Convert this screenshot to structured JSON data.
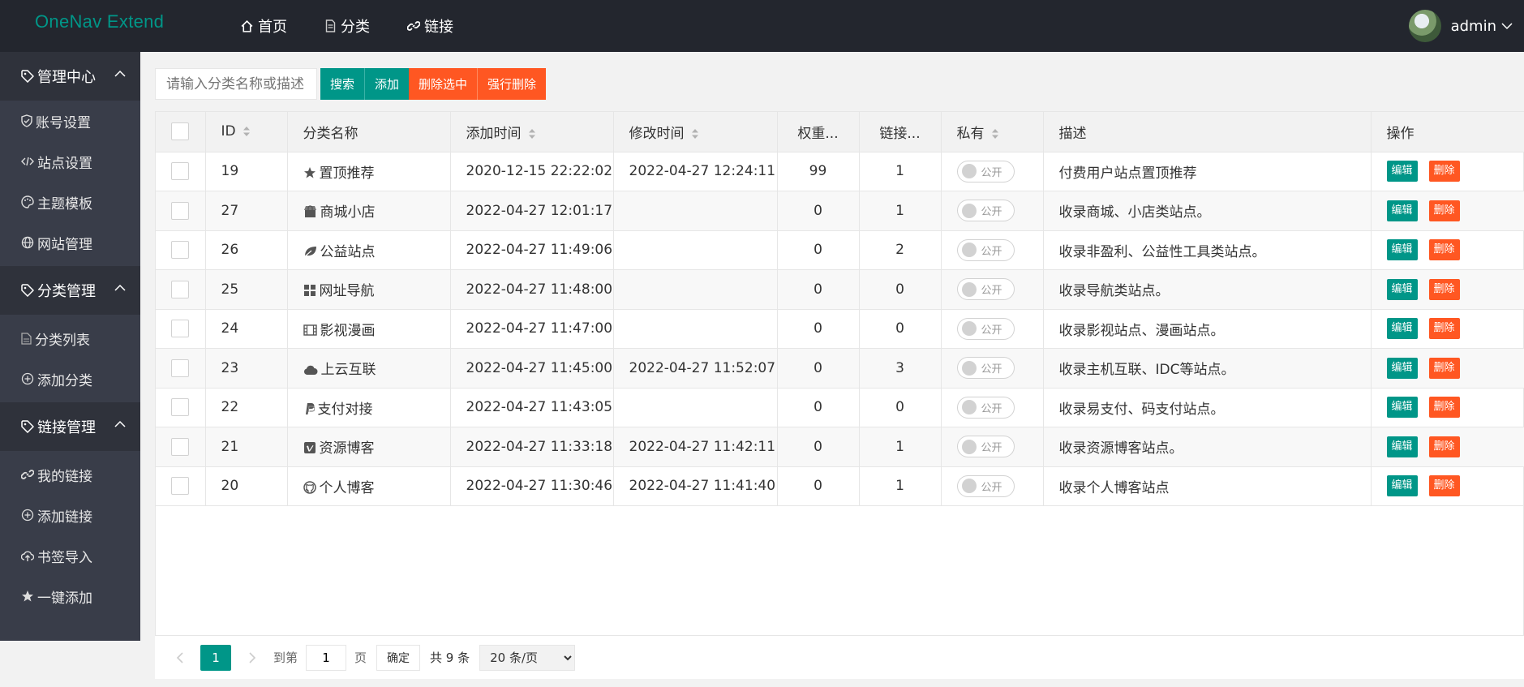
{
  "app": {
    "title": "OneNav Extend"
  },
  "topnav": [
    {
      "icon": "home-icon",
      "label": "首页"
    },
    {
      "icon": "document-icon",
      "label": "分类"
    },
    {
      "icon": "link-icon",
      "label": "链接"
    }
  ],
  "user": {
    "name": "admin"
  },
  "sidebar": {
    "groups": [
      {
        "title": "管理中心",
        "items": [
          {
            "icon": "shield-icon",
            "label": "账号设置"
          },
          {
            "icon": "code-icon",
            "label": "站点设置"
          },
          {
            "icon": "palette-icon",
            "label": "主题模板"
          },
          {
            "icon": "globe-icon",
            "label": "网站管理"
          }
        ]
      },
      {
        "title": "分类管理",
        "items": [
          {
            "icon": "file-icon",
            "label": "分类列表"
          },
          {
            "icon": "plus-circle-icon",
            "label": "添加分类"
          }
        ]
      },
      {
        "title": "链接管理",
        "items": [
          {
            "icon": "link-icon",
            "label": "我的链接"
          },
          {
            "icon": "plus-circle-icon",
            "label": "添加链接"
          },
          {
            "icon": "cloud-upload-icon",
            "label": "书签导入"
          },
          {
            "icon": "star-icon",
            "label": "一键添加"
          }
        ]
      }
    ]
  },
  "toolbar": {
    "search_placeholder": "请输入分类名称或描述",
    "search_label": "搜索",
    "add_label": "添加",
    "delete_selected_label": "删除选中",
    "force_delete_label": "强行删除"
  },
  "table": {
    "headers": {
      "id": "ID",
      "name": "分类名称",
      "add_time": "添加时间",
      "mod_time": "修改时间",
      "weight": "权重...",
      "links": "链接...",
      "private": "私有",
      "desc": "描述",
      "ops": "操作"
    },
    "switch_label": "公开",
    "edit_label": "编辑",
    "delete_label": "删除",
    "rows": [
      {
        "id": "19",
        "icon": "star-icon",
        "name": "置顶推荐",
        "add_time": "2020-12-15 22:22:02",
        "mod_time": "2022-04-27 12:24:11",
        "weight": "99",
        "links": "1",
        "desc": "付费用户站点置顶推荐"
      },
      {
        "id": "27",
        "icon": "shop-icon",
        "name": "商城小店",
        "add_time": "2022-04-27 12:01:17",
        "mod_time": "",
        "weight": "0",
        "links": "1",
        "desc": "收录商城、小店类站点。"
      },
      {
        "id": "26",
        "icon": "leaf-icon",
        "name": "公益站点",
        "add_time": "2022-04-27 11:49:06",
        "mod_time": "",
        "weight": "0",
        "links": "2",
        "desc": "收录非盈利、公益性工具类站点。"
      },
      {
        "id": "25",
        "icon": "windows-icon",
        "name": "网址导航",
        "add_time": "2022-04-27 11:48:00",
        "mod_time": "",
        "weight": "0",
        "links": "0",
        "desc": "收录导航类站点。"
      },
      {
        "id": "24",
        "icon": "film-icon",
        "name": "影视漫画",
        "add_time": "2022-04-27 11:47:00",
        "mod_time": "",
        "weight": "0",
        "links": "0",
        "desc": "收录影视站点、漫画站点。"
      },
      {
        "id": "23",
        "icon": "cloud-icon",
        "name": "上云互联",
        "add_time": "2022-04-27 11:45:00",
        "mod_time": "2022-04-27 11:52:07",
        "weight": "0",
        "links": "3",
        "desc": "收录主机互联、IDC等站点。"
      },
      {
        "id": "22",
        "icon": "paypal-icon",
        "name": "支付对接",
        "add_time": "2022-04-27 11:43:05",
        "mod_time": "",
        "weight": "0",
        "links": "0",
        "desc": "收录易支付、码支付站点。"
      },
      {
        "id": "21",
        "icon": "vimeo-icon",
        "name": "资源博客",
        "add_time": "2022-04-27 11:33:18",
        "mod_time": "2022-04-27 11:42:11",
        "weight": "0",
        "links": "1",
        "desc": "收录资源博客站点。"
      },
      {
        "id": "20",
        "icon": "github-icon",
        "name": "个人博客",
        "add_time": "2022-04-27 11:30:46",
        "mod_time": "2022-04-27 11:41:40",
        "weight": "0",
        "links": "1",
        "desc": "收录个人博客站点"
      }
    ]
  },
  "pager": {
    "current_page": "1",
    "goto_label": "到第",
    "page_value": "1",
    "page_unit": "页",
    "confirm_label": "确定",
    "total_label": "共 9 条",
    "page_size_selected": "20 条/页"
  },
  "colors": {
    "accent": "#009688",
    "danger": "#ff5722",
    "header_bg": "#23262e",
    "sidebar_bg": "#393d49"
  }
}
